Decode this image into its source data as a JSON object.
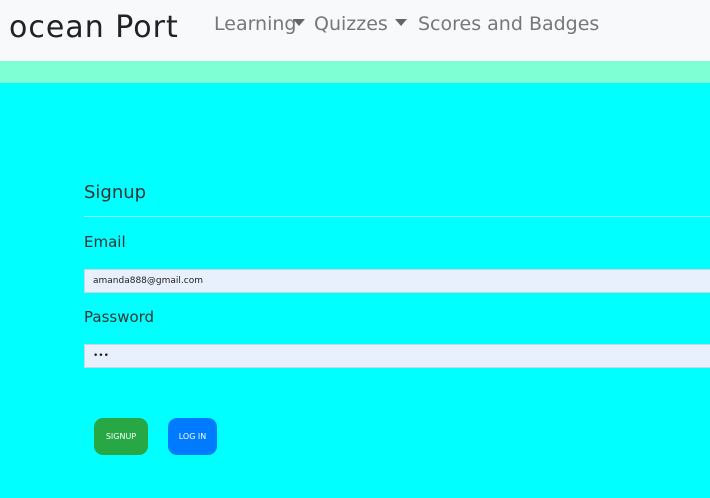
{
  "navbar": {
    "brand": "ocean Port",
    "items": [
      {
        "label": "Learning"
      },
      {
        "label": "Quizzes"
      },
      {
        "label": "Scores and Badges"
      }
    ]
  },
  "form": {
    "title": "Signup",
    "email_label": "Email",
    "email_value": "amanda888@gmail.com",
    "password_label": "Password",
    "password_value": "•••"
  },
  "buttons": {
    "signup": "SIGNUP",
    "login": "LOG IN"
  },
  "colors": {
    "page_background": "#00ffff",
    "accent_stripe": "#7fffd4",
    "signup_button": "#28a745",
    "login_button": "#007bff"
  }
}
